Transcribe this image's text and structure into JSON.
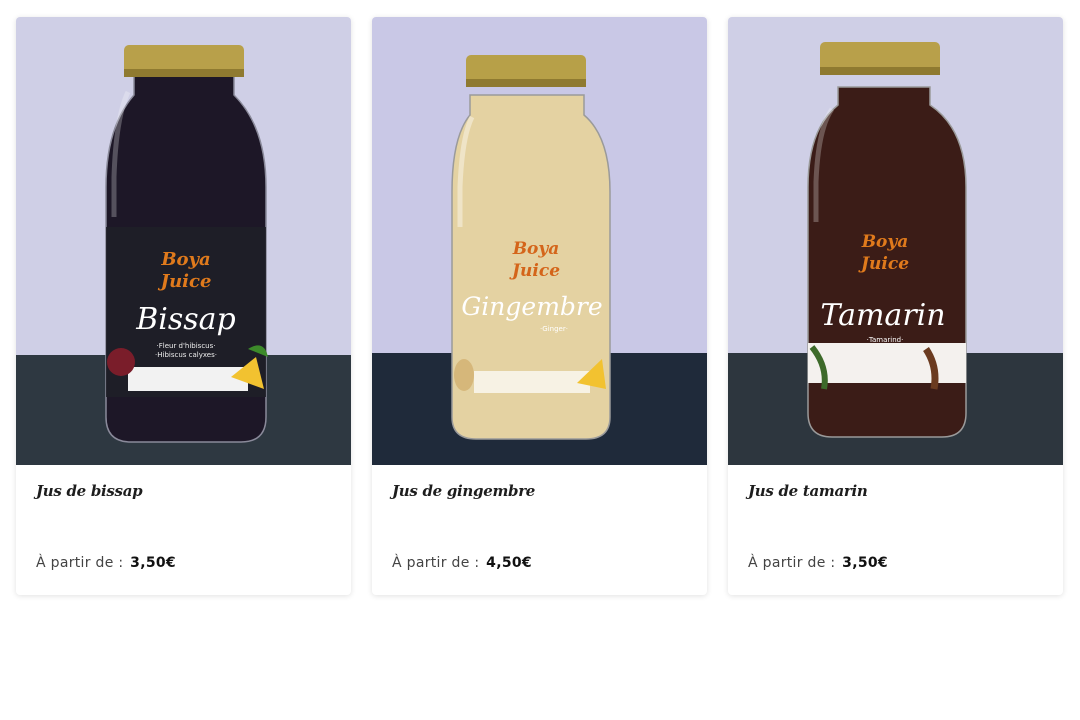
{
  "products": [
    {
      "name": "Jus de bissap",
      "price_prefix": "À partir de :",
      "price": "3,50€",
      "label": {
        "brand_line1": "Boya",
        "brand_line2": "Juice",
        "flavor": "Bissap",
        "sub1": "·Fleur d'hibiscus·",
        "sub2": "·Hibiscus calyxes·"
      }
    },
    {
      "name": "Jus de gingembre",
      "price_prefix": "À partir de :",
      "price": "4,50€",
      "label": {
        "brand_line1": "Boya",
        "brand_line2": "Juice",
        "flavor": "Gingembre",
        "sub1": "·Ginger·",
        "sub2": ""
      }
    },
    {
      "name": "Jus de tamarin",
      "price_prefix": "À partir de :",
      "price": "3,50€",
      "label": {
        "brand_line1": "Boya",
        "brand_line2": "Juice",
        "flavor": "Tamarin",
        "sub1": "·Tamarind·",
        "sub2": ""
      }
    }
  ],
  "colors": {
    "wall": "#cdcde6",
    "table": "#2f3840",
    "cap": "#b9a24a",
    "bissap": "#1b1625",
    "gingembre": "#e6d4a4",
    "tamarin": "#3a1b16",
    "brand": "#e07a1c"
  }
}
